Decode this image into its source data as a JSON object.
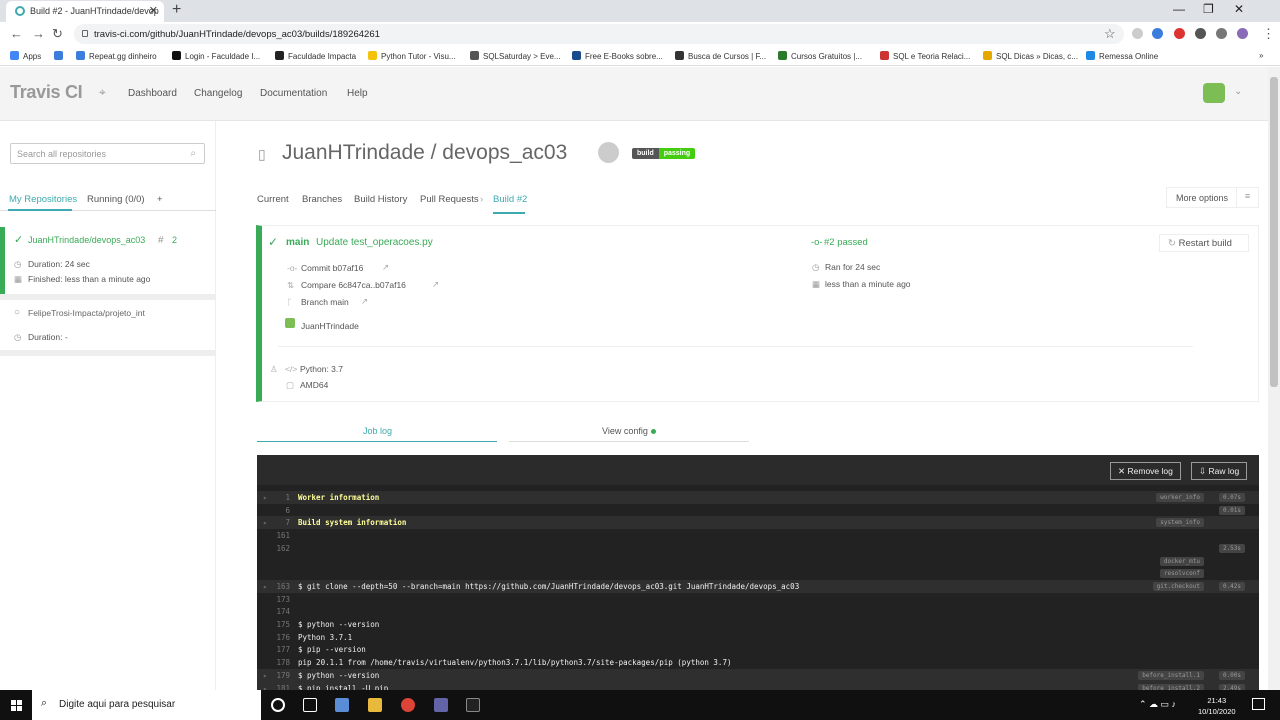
{
  "browser": {
    "tab_title": "Build #2 - JuanHTrindade/devop",
    "url": "travis-ci.com/github/JuanHTrindade/devops_ac03/builds/189264261",
    "bookmarks": [
      "Apps",
      "Repeat.gg dinheiro",
      "Login - Faculdade I...",
      "Faculdade Impacta",
      "Python Tutor - Visu...",
      "SQLSaturday > Eve...",
      "Free E-Books sobre...",
      "Busca de Cursos | F...",
      "Cursos Gratuitos |...",
      "SQL e Teoria Relaci...",
      "SQL Dicas » Dicas, c...",
      "Remessa Online"
    ]
  },
  "header": {
    "logo": "Travis CI",
    "nav": [
      "Dashboard",
      "Changelog",
      "Documentation",
      "Help"
    ]
  },
  "sidebar": {
    "search_placeholder": "Search all repositories",
    "tabs": [
      "My Repositories",
      "Running (0/0)",
      "+"
    ],
    "repos": [
      {
        "name": "JuanHTrindade/devops_ac03",
        "number": "2",
        "duration": "Duration: 24 sec",
        "finished": "Finished: less than a minute ago"
      },
      {
        "name": "FelipeTrosi-Impacta/projeto_int",
        "duration": "Duration: -"
      }
    ]
  },
  "repo": {
    "title": "JuanHTrindade / devops_ac03",
    "badge_left": "build",
    "badge_right": "passing",
    "subnav": [
      "Current",
      "Branches",
      "Build History",
      "Pull Requests",
      "Build #2"
    ],
    "more_options": "More options"
  },
  "build": {
    "branch": "main",
    "message": "Update test_operacoes.py",
    "status": "#2 passed",
    "restart": "Restart build",
    "commit": "Commit b07af16",
    "compare": "Compare 6c847ca..b07af16",
    "branch_line": "Branch main",
    "author": "JuanHTrindade",
    "ran_for": "Ran for 24 sec",
    "time_ago": "less than a minute ago",
    "python": "Python: 3.7",
    "arch": "AMD64"
  },
  "log": {
    "tabs": [
      "Job log",
      "View config"
    ],
    "remove_log": "Remove log",
    "raw_log": "Raw log",
    "lines": [
      {
        "num": "1",
        "text": "Worker information",
        "yellow": true,
        "fold": true,
        "tag": "worker_info",
        "time": "0.07s"
      },
      {
        "num": "6",
        "text": "",
        "time": "0.01s"
      },
      {
        "num": "7",
        "text": "Build system information",
        "yellow": true,
        "fold": true,
        "tag": "system_info"
      },
      {
        "num": "161",
        "text": ""
      },
      {
        "num": "162",
        "text": "",
        "time": "2.53s"
      },
      {
        "num": "",
        "text": "",
        "tag": "docker_mtu"
      },
      {
        "num": "",
        "text": "",
        "tag": "resolvconf"
      },
      {
        "num": "163",
        "text": "$ git clone --depth=50 --branch=main https://github.com/JuanHTrindade/devops_ac03.git JuanHTrindade/devops_ac03",
        "fold": true,
        "tag": "git.checkout",
        "time": "0.42s"
      },
      {
        "num": "173",
        "text": ""
      },
      {
        "num": "174",
        "text": ""
      },
      {
        "num": "175",
        "text": "$ python --version"
      },
      {
        "num": "176",
        "text": "Python 3.7.1"
      },
      {
        "num": "177",
        "text": "$ pip --version"
      },
      {
        "num": "178",
        "text": "pip 20.1.1 from /home/travis/virtualenv/python3.7.1/lib/python3.7/site-packages/pip (python 3.7)"
      },
      {
        "num": "179",
        "text": "$ python --version",
        "fold": true,
        "tag": "before_install.1",
        "time": "0.00s"
      },
      {
        "num": "181",
        "text": "$ pip install -U pip",
        "fold": true,
        "tag": "before_install.2",
        "time": "2.49s"
      }
    ]
  },
  "taskbar": {
    "search": "Digite aqui para pesquisar",
    "time": "21:43",
    "date": "10/10/2020"
  }
}
